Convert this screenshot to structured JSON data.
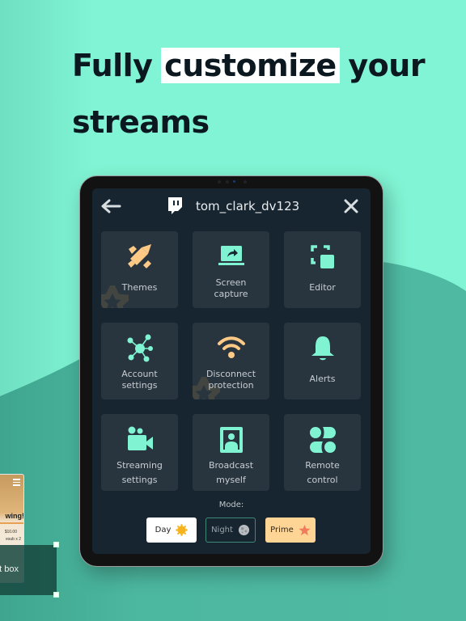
{
  "headline": {
    "before": "Fully ",
    "highlight": "customize",
    "after": " your streams"
  },
  "colors": {
    "background_light": "#80f4d4",
    "background_dark": "#4ab59e",
    "accent_mint": "#7ff3d2",
    "accent_orange": "#ffc987",
    "screen_bg": "#172530",
    "tile_bg": "#28353f"
  },
  "topbar": {
    "back_icon": "arrow-left-icon",
    "platform_icon": "twitch-icon",
    "username": "tom_clark_dv123",
    "close_icon": "close-icon"
  },
  "tiles": [
    {
      "label": "Themes",
      "icon": "paint-pencil-icon"
    },
    {
      "label": "Screen capture",
      "icon": "laptop-share-icon"
    },
    {
      "label": "Editor",
      "icon": "resize-frame-icon"
    },
    {
      "label": "Account settings",
      "icon": "network-nodes-icon"
    },
    {
      "label": "Disconnect protection",
      "icon": "wifi-icon"
    },
    {
      "label": "Alerts",
      "icon": "bell-icon"
    },
    {
      "label": "Streaming settings",
      "icon": "video-camera-icon"
    },
    {
      "label": "Broadcast myself",
      "icon": "portrait-frame-icon"
    },
    {
      "label": "Remote control",
      "icon": "remote-shapes-icon"
    }
  ],
  "mode": {
    "label": "Mode:",
    "options": [
      {
        "label": "Day",
        "icon": "sun-icon"
      },
      {
        "label": "Night",
        "icon": "moon-icon",
        "selected": true
      },
      {
        "label": "Prime",
        "icon": "star-icon"
      }
    ]
  },
  "preview": {
    "title": "wing!",
    "price": "$10.00",
    "sub": "esub x 2",
    "text_box_label": "t box"
  }
}
